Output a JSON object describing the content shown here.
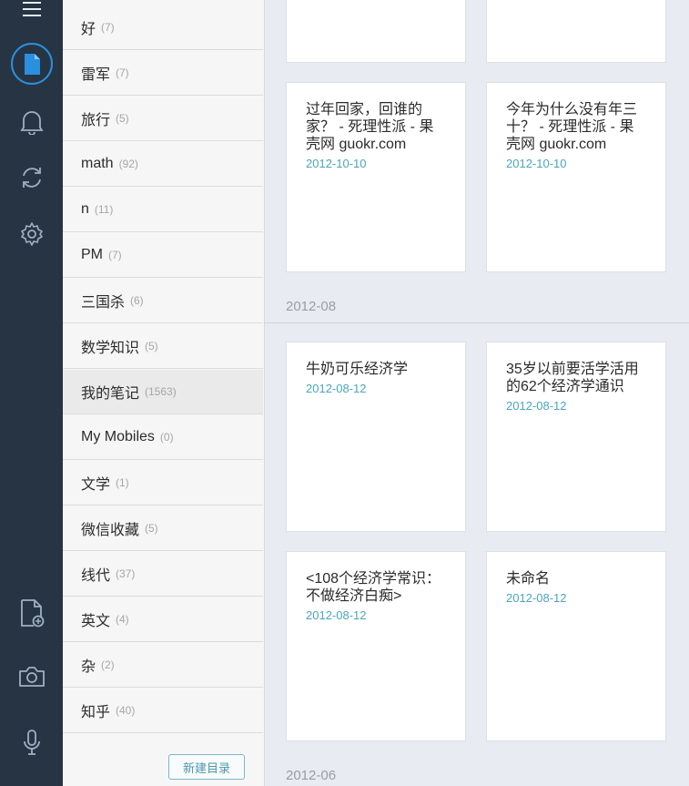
{
  "rail": {
    "icons": [
      "menu-icon",
      "note-icon",
      "reminder-bell-icon",
      "sync-icon",
      "settings-gear-icon",
      "new-note-icon",
      "camera-icon",
      "microphone-icon"
    ]
  },
  "notebooks": [
    {
      "name": "好",
      "count": "(7)"
    },
    {
      "name": "雷军",
      "count": "(7)"
    },
    {
      "name": "旅行",
      "count": "(5)"
    },
    {
      "name": "math",
      "count": "(92)"
    },
    {
      "name": "n",
      "count": "(11)"
    },
    {
      "name": "PM",
      "count": "(7)"
    },
    {
      "name": "三国杀",
      "count": "(6)"
    },
    {
      "name": "数学知识",
      "count": "(5)"
    },
    {
      "name": "我的笔记",
      "count": "(1563)"
    },
    {
      "name": "My Mobiles",
      "count": "(0)"
    },
    {
      "name": "文学",
      "count": "(1)"
    },
    {
      "name": "微信收藏",
      "count": "(5)"
    },
    {
      "name": "线代",
      "count": "(37)"
    },
    {
      "name": "英文",
      "count": "(4)"
    },
    {
      "name": "杂",
      "count": "(2)"
    },
    {
      "name": "知乎",
      "count": "(40)"
    }
  ],
  "selected_notebook": "我的笔记",
  "new_notebook_label": "新建目录",
  "sections": [
    {
      "label": "2012-08"
    },
    {
      "label": "2012-06"
    }
  ],
  "notes": [
    {
      "title": "过年回家，回谁的家？ - 死理性派 - 果壳网 guokr.com",
      "date": "2012-10-10"
    },
    {
      "title": "今年为什么没有年三十？ - 死理性派 - 果壳网 guokr.com",
      "date": "2012-10-10"
    },
    {
      "title": "牛奶可乐经济学",
      "date": "2012-08-12"
    },
    {
      "title": "35岁以前要活学活用的62个经济学通识",
      "date": "2012-08-12"
    },
    {
      "title": "<108个经济学常识：不做经济白痴>",
      "date": "2012-08-12"
    },
    {
      "title": "未命名",
      "date": "2012-08-12"
    }
  ],
  "colors": {
    "rail": "#263444",
    "accent": "#2b8fe0",
    "date": "#49a6bd"
  }
}
